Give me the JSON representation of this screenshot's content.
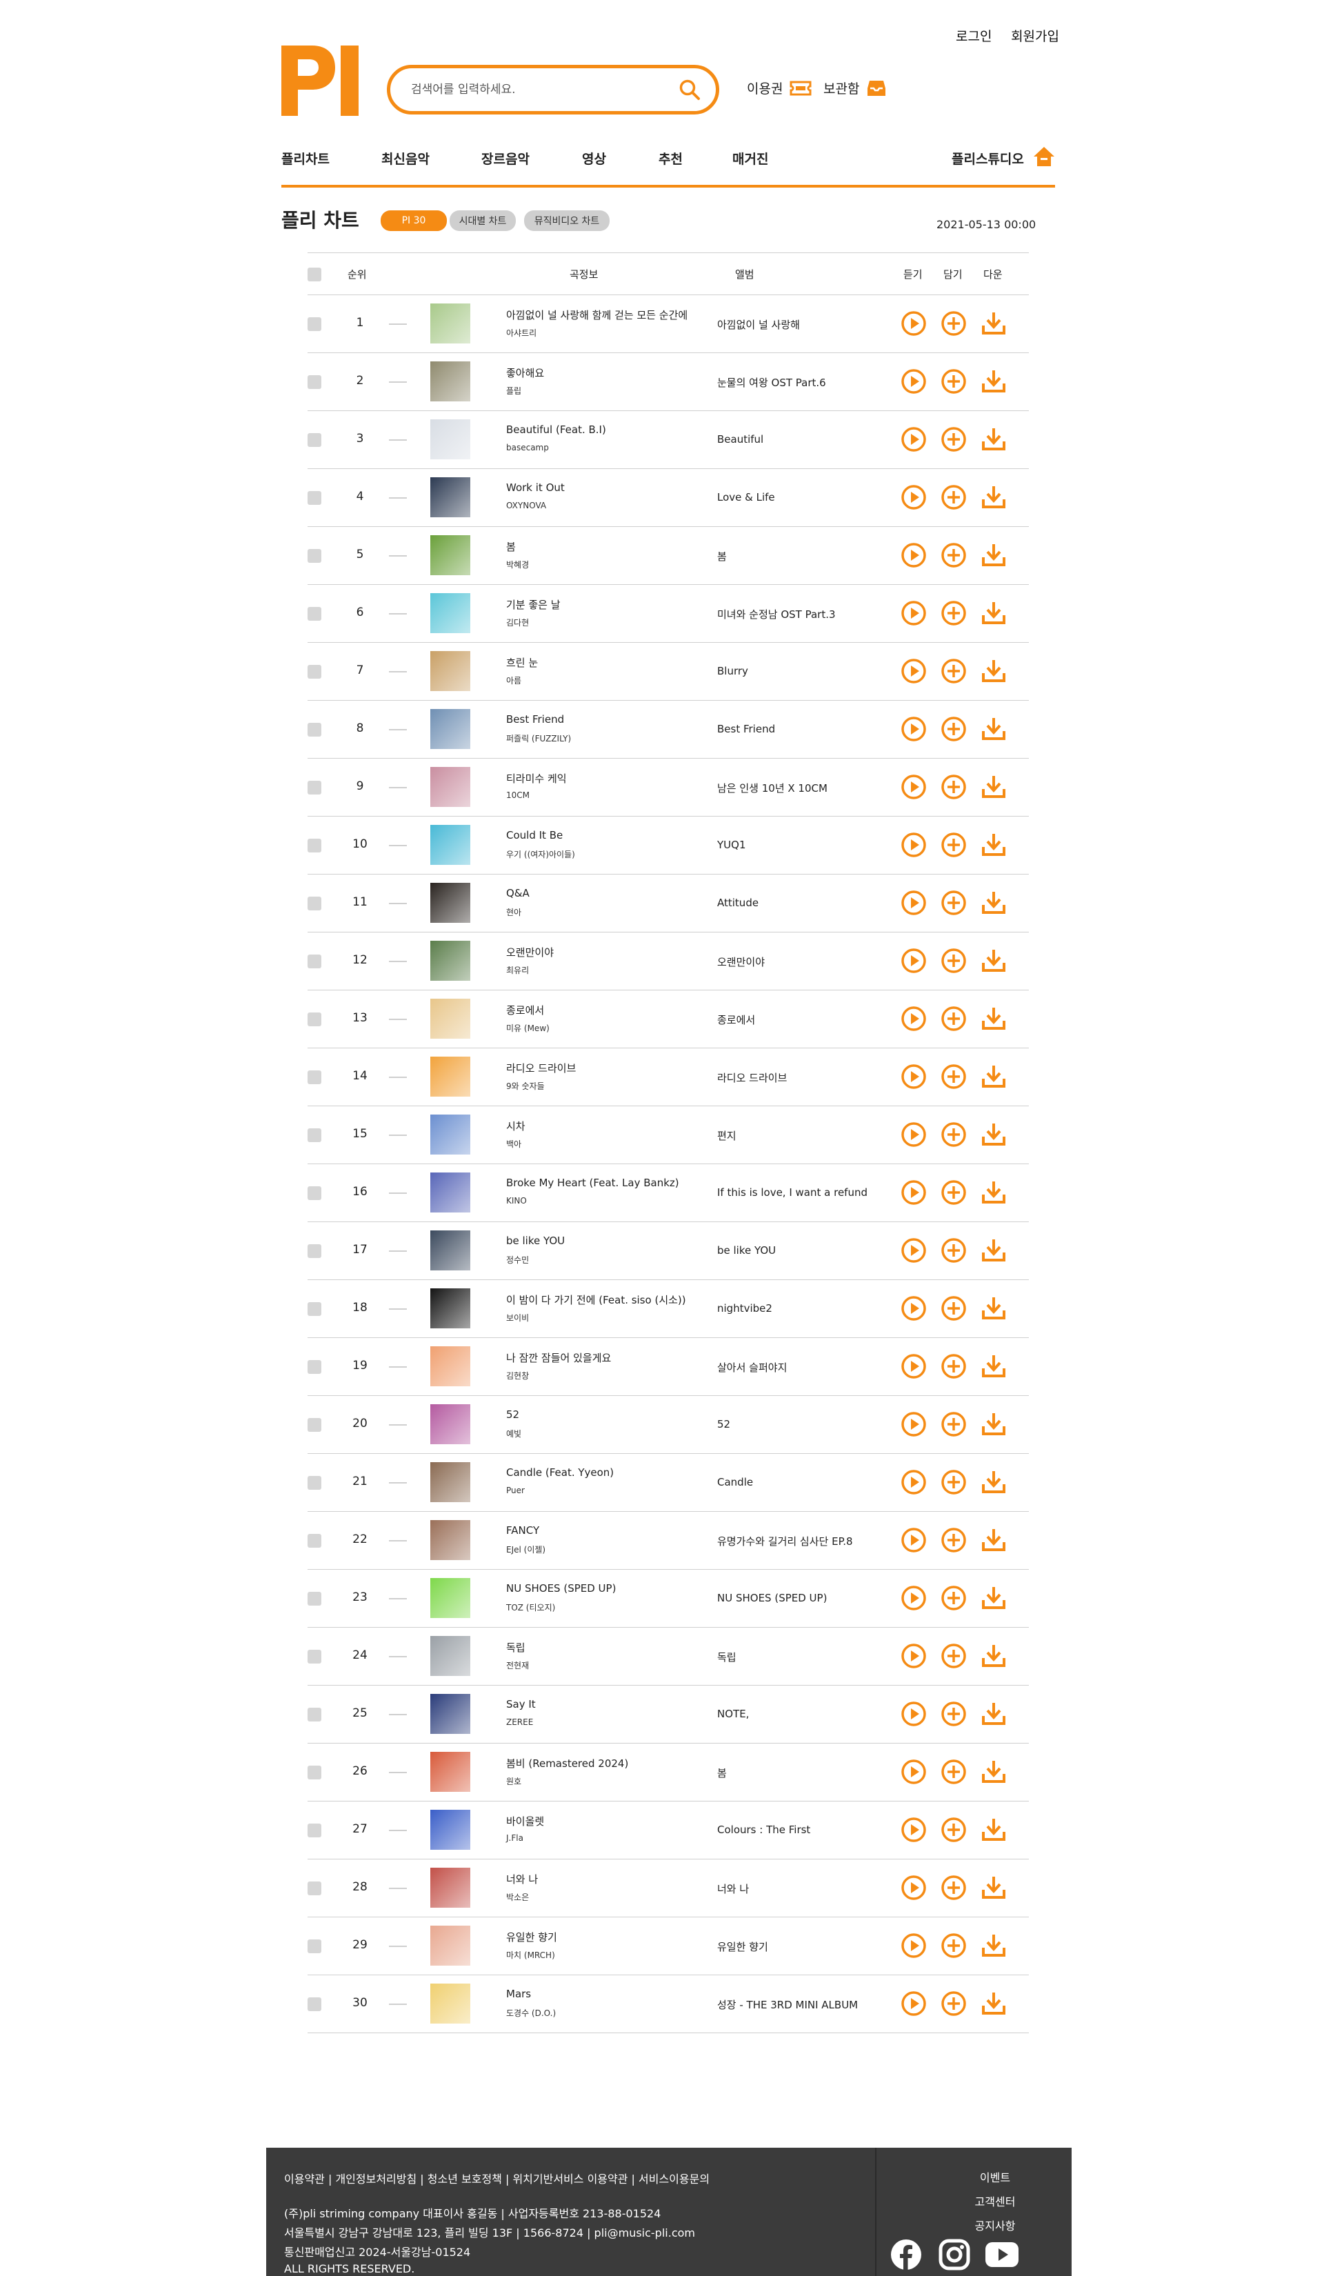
{
  "header": {
    "login": "로그인",
    "signup": "회원가입",
    "logo": "PI",
    "search_placeholder": "검색어를 입력하세요.",
    "voucher": "이용권",
    "locker": "보관함"
  },
  "nav": {
    "items": [
      "플리차트",
      "최신음악",
      "장르음악",
      "영상",
      "추천",
      "매거진"
    ],
    "studio": "플리스튜디오"
  },
  "chart": {
    "title": "플리 차트",
    "tabs": [
      "PI 30",
      "시대별 차트",
      "뮤직비디오 차트"
    ],
    "date": "2021-05-13 00:00",
    "columns": {
      "rank": "순위",
      "info": "곡정보",
      "album": "앨범",
      "listen": "듣기",
      "add": "담기",
      "download": "다운"
    }
  },
  "colors": {
    "accent": "#f58b14",
    "footer_bg": "#3b3b3b",
    "divider": "#cfcfcf"
  },
  "songs": [
    {
      "rank": "1",
      "title": "아낌없이 널 사랑해 함께 걷는 모든 순간에",
      "artist": "아샤트리",
      "album": "아낌없이 널 사랑해",
      "cover": "#a8c98a"
    },
    {
      "rank": "2",
      "title": "좋아해요",
      "artist": "플립",
      "album": "눈물의 여왕 OST Part.6",
      "cover": "#8f8a6e"
    },
    {
      "rank": "3",
      "title": "Beautiful (Feat. B.I)",
      "artist": "basecamp",
      "album": "Beautiful",
      "cover": "#d8dde4"
    },
    {
      "rank": "4",
      "title": "Work it Out",
      "artist": "OXYNOVA",
      "album": "Love & Life",
      "cover": "#2c3a52"
    },
    {
      "rank": "5",
      "title": "봄",
      "artist": "박혜경",
      "album": "봄",
      "cover": "#6aa03a"
    },
    {
      "rank": "6",
      "title": "기분 좋은 날",
      "artist": "김다현",
      "album": "미녀와 순정남 OST Part.3",
      "cover": "#5bc6d8"
    },
    {
      "rank": "7",
      "title": "흐린 눈",
      "artist": "아름",
      "album": "Blurry",
      "cover": "#c9a066"
    },
    {
      "rank": "8",
      "title": "Best Friend",
      "artist": "퍼즐릭 (FUZZILY)",
      "album": "Best Friend",
      "cover": "#6f8fb3"
    },
    {
      "rank": "9",
      "title": "티라미수 케익",
      "artist": "10CM",
      "album": "남은 인생 10년 X 10CM",
      "cover": "#c98ea0"
    },
    {
      "rank": "10",
      "title": "Could It Be",
      "artist": "우기 ((여자)아이들)",
      "album": "YUQ1",
      "cover": "#48b9d6"
    },
    {
      "rank": "11",
      "title": "Q&A",
      "artist": "현아",
      "album": "Attitude",
      "cover": "#2a2420"
    },
    {
      "rank": "12",
      "title": "오랜만이야",
      "artist": "최유리",
      "album": "오랜만이야",
      "cover": "#5a7d4a"
    },
    {
      "rank": "13",
      "title": "종로에서",
      "artist": "미유 (Mew)",
      "album": "종로에서",
      "cover": "#e8c68a"
    },
    {
      "rank": "14",
      "title": "라디오 드라이브",
      "artist": "9와 숫자들",
      "album": "라디오 드라이브",
      "cover": "#f2a33c"
    },
    {
      "rank": "15",
      "title": "시차",
      "artist": "백아",
      "album": "편지",
      "cover": "#6b8fd0"
    },
    {
      "rank": "16",
      "title": "Broke My Heart (Feat. Lay Bankz)",
      "artist": "KINO",
      "album": "If this is love, I want a refund",
      "cover": "#5866b8"
    },
    {
      "rank": "17",
      "title": "be like YOU",
      "artist": "정수민",
      "album": "be like YOU",
      "cover": "#3c4a5e"
    },
    {
      "rank": "18",
      "title": "이 밤이 다 가기 전에 (Feat. siso (시소))",
      "artist": "보이비",
      "album": "nightvibe2",
      "cover": "#141414"
    },
    {
      "rank": "19",
      "title": "나 잠깐 잠들어 있을게요",
      "artist": "김현창",
      "album": "살아서 슬퍼야지",
      "cover": "#f0a070"
    },
    {
      "rank": "20",
      "title": "52",
      "artist": "예빛",
      "album": "52",
      "cover": "#b45aa0"
    },
    {
      "rank": "21",
      "title": "Candle (Feat. Yyeon)",
      "artist": "Puer",
      "album": "Candle",
      "cover": "#8a6a52"
    },
    {
      "rank": "22",
      "title": "FANCY",
      "artist": "EJel (이젤)",
      "album": "유명가수와 길거리 심사단 EP.8",
      "cover": "#9a6f58"
    },
    {
      "rank": "23",
      "title": "NU SHOES (SPED UP)",
      "artist": "TOZ (티오지)",
      "album": "NU SHOES (SPED UP)",
      "cover": "#7ed84a"
    },
    {
      "rank": "24",
      "title": "독립",
      "artist": "전현재",
      "album": "독립",
      "cover": "#9aa0a6"
    },
    {
      "rank": "25",
      "title": "Say It",
      "artist": "ZEREE",
      "album": "NOTE,",
      "cover": "#2a3c7a"
    },
    {
      "rank": "26",
      "title": "봄비 (Remastered 2024)",
      "artist": "원호",
      "album": "봄",
      "cover": "#d85a3a"
    },
    {
      "rank": "27",
      "title": "바이올렛",
      "artist": "J.Fla",
      "album": "Colours : The First",
      "cover": "#3a5ec8"
    },
    {
      "rank": "28",
      "title": "너와 나",
      "artist": "박소은",
      "album": "너와 나",
      "cover": "#c25048"
    },
    {
      "rank": "29",
      "title": "유일한 향기",
      "artist": "마치 (MRCH)",
      "album": "유일한 향기",
      "cover": "#e8a890"
    },
    {
      "rank": "30",
      "title": "Mars",
      "artist": "도경수 (D.O.)",
      "album": "성장 - THE 3RD MINI ALBUM",
      "cover": "#f0d070"
    }
  ],
  "footer": {
    "line1": "이용약관 | 개인정보처리방침 | 청소년 보호정책 | 위치기반서비스 이용약관 | 서비스이용문의",
    "line2": "(주)pli striming company 대표이사 홍길동 | 사업자등록번호 213-88-01524",
    "line3": "서울특별시 강남구 강남대로 123, 플리 빌딩 13F | 1566-8724 | pli@music-pli.com",
    "line4": "통신판매업신고 2024-서울강남-01524",
    "line5": "ALL RIGHTS RESERVED.",
    "links": [
      "이벤트",
      "고객센터",
      "공지사항"
    ],
    "social_icons": [
      "facebook-icon",
      "instagram-icon",
      "youtube-icon"
    ]
  }
}
